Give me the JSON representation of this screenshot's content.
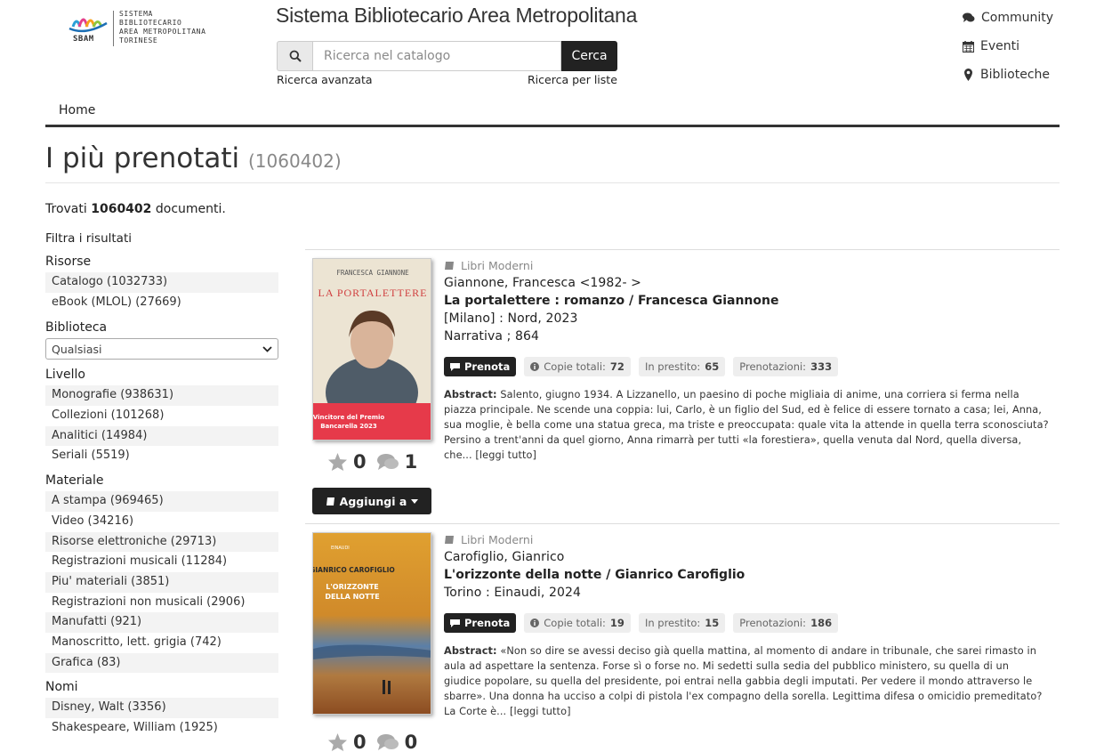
{
  "header": {
    "logo_short": "SBAM",
    "logo_text": [
      "SISTEMA",
      "BIBLIOTECARIO",
      "AREA METROPOLITANA",
      "TORINESE"
    ],
    "site_title": "Sistema Bibliotecario Area Metropolitana",
    "search": {
      "placeholder": "Ricerca nel catalogo",
      "value": "",
      "button": "Cerca"
    },
    "advanced_link": "Ricerca avanzata",
    "lists_link": "Ricerca per liste",
    "topnav": [
      {
        "label": "Community",
        "icon": "comments-icon"
      },
      {
        "label": "Eventi",
        "icon": "calendar-icon"
      },
      {
        "label": "Biblioteche",
        "icon": "map-marker-icon"
      }
    ]
  },
  "nav": {
    "home": "Home"
  },
  "page": {
    "title": "I più prenotati",
    "count": "(1060402)",
    "found_prefix": "Trovati",
    "found_count": "1060402",
    "found_suffix": "documenti."
  },
  "sidebar": {
    "filter_heading": "Filtra i risultati",
    "risorse": {
      "title": "Risorse",
      "items": [
        "Catalogo (1032733)",
        "eBook (MLOL) (27669)"
      ]
    },
    "biblioteca": {
      "title": "Biblioteca",
      "selected": "Qualsiasi"
    },
    "livello": {
      "title": "Livello",
      "items": [
        "Monografie (938631)",
        "Collezioni (101268)",
        "Analitici (14984)",
        "Seriali (5519)"
      ]
    },
    "materiale": {
      "title": "Materiale",
      "items": [
        "A stampa (969465)",
        "Video (34216)",
        "Risorse elettroniche (29713)",
        "Registrazioni musicali (11284)",
        "Piu' materiali (3851)",
        "Registrazioni non musicali (2906)",
        "Manufatti (921)",
        "Manoscritto, lett. grigia (742)",
        "Grafica (83)"
      ]
    },
    "nomi": {
      "title": "Nomi",
      "items": [
        "Disney, Walt (3356)",
        "Shakespeare, William (1925)"
      ]
    }
  },
  "results": [
    {
      "type": "Libri Moderni",
      "author": "Giannone, Francesca <1982- >",
      "title": "La portalettere : romanzo / Francesca Giannone",
      "publication": "[Milano] : Nord, 2023",
      "series": "Narrativa ; 864",
      "reserve_label": "Prenota",
      "copies_label": "Copie totali:",
      "copies": "72",
      "loan_label": "In prestito:",
      "loan": "65",
      "holds_label": "Prenotazioni:",
      "holds": "333",
      "abstract_label": "Abstract:",
      "abstract": "Salento, giugno 1934. A Lizzanello, un paesino di poche migliaia di anime, una corriera si ferma nella piazza principale. Ne scende una coppia: lui, Carlo, è un figlio del Sud, ed è felice di essere tornato a casa; lei, Anna, sua moglie, è bella come una statua greca, ma triste e preoccupata: quale vita la attende in quella terra sconosciuta? Persino a trent'anni da quel giorno, Anna rimarrà per tutti «la forestiera», quella venuta dal Nord, quella diversa, che...",
      "read_more": "[leggi tutto]",
      "stars": "0",
      "comments": "1",
      "add_label": "Aggiungi a",
      "cover": {
        "author": "FRANCESCA GIANNONE",
        "title": "LA PORTALETTERE",
        "band_line1": "Vincitore del Premio",
        "band_line2": "Bancarella 2023"
      }
    },
    {
      "type": "Libri Moderni",
      "author": "Carofiglio, Gianrico",
      "title": "L'orizzonte della notte / Gianrico Carofiglio",
      "publication": "Torino : Einaudi, 2024",
      "reserve_label": "Prenota",
      "copies_label": "Copie totali:",
      "copies": "19",
      "loan_label": "In prestito:",
      "loan": "15",
      "holds_label": "Prenotazioni:",
      "holds": "186",
      "abstract_label": "Abstract:",
      "abstract": "«Non so dire se avessi deciso già quella mattina, al momento di andare in tribunale, che sarei rimasto in aula ad aspettare la sentenza. Forse sì o forse no. Mi sedetti sulla sedia del pubblico ministero, su quella di un giudice popolare, su quella del presidente, poi entrai nella gabbia degli imputati. Per vedere il mondo attraverso le sbarre». Una donna ha ucciso a colpi di pistola l'ex compagno della sorella. Legittima difesa o omicidio premeditato? La Corte è...",
      "read_more": "[leggi tutto]",
      "stars": "0",
      "comments": "0",
      "cover": {
        "author": "GIANRICO CAROFIGLIO",
        "title_line1": "L'ORIZZONTE",
        "title_line2": "DELLA NOTTE",
        "publisher": "EINAUDI"
      }
    }
  ]
}
